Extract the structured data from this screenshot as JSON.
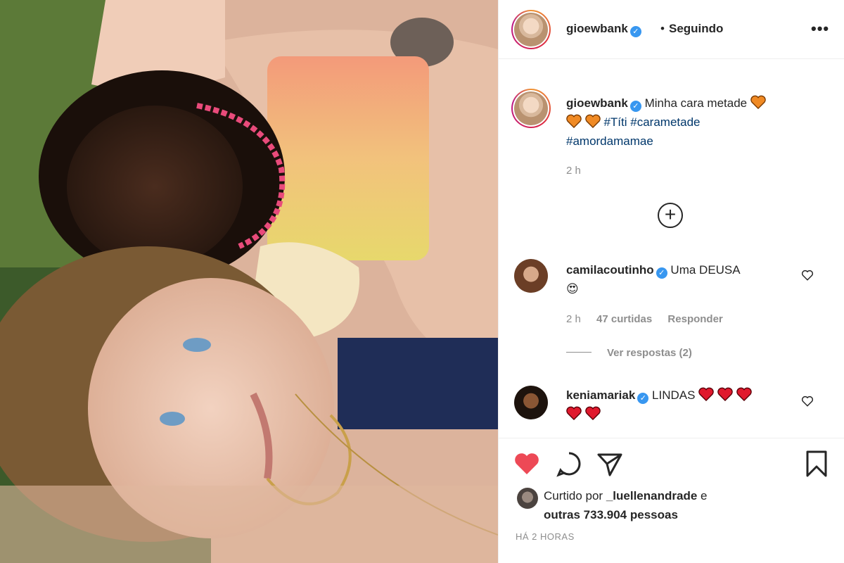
{
  "header": {
    "username": "gioewbank",
    "separator": "•",
    "follow_status": "Seguindo",
    "more": "•••"
  },
  "caption": {
    "username": "gioewbank",
    "text": "Minha cara metade",
    "hashtags": [
      "#Títi",
      "#carametade",
      "#amordamamae"
    ],
    "time": "2 h"
  },
  "comments": [
    {
      "username": "camilacoutinho",
      "text": "Uma DEUSA",
      "emoji": "😍",
      "time": "2 h",
      "likes": "47 curtidas",
      "reply": "Responder",
      "view_replies": "Ver respostas (2)"
    },
    {
      "username": "keniamariak",
      "text": "LINDAS"
    }
  ],
  "load_more_icon": "plus-circle-icon",
  "actions": {
    "like_icon": "heart-filled-icon",
    "comment_icon": "comment-bubble-icon",
    "share_icon": "paper-plane-icon",
    "save_icon": "bookmark-icon",
    "like_color": "#ed4956"
  },
  "likes": {
    "prefix": "Curtido por",
    "user": "_luellenandrade",
    "connector": "e",
    "others": "outras 733.904 pessoas"
  },
  "post_time": "HÁ 2 HORAS",
  "colors": {
    "hashtag": "#00376b",
    "verified": "#3897f0",
    "heart_orange": "#f08a24",
    "heart_red": "#e0192d"
  }
}
